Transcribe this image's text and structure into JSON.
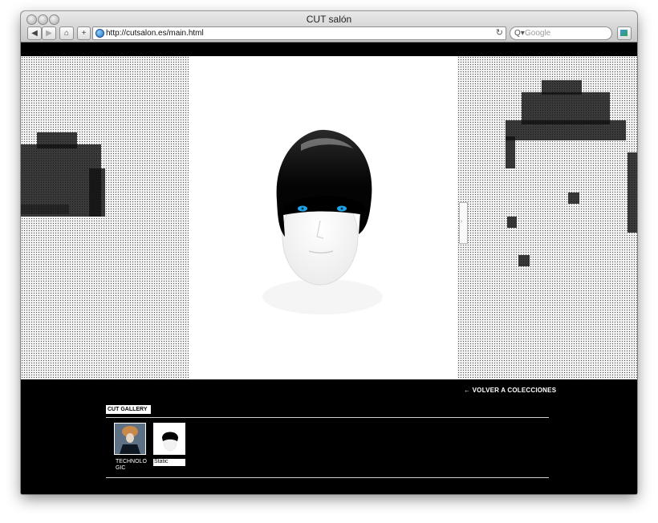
{
  "browser": {
    "window_title": "CUT salón",
    "url": "http://cutsalon.es/main.html",
    "search_placeholder": "Google",
    "back_glyph": "◀",
    "forward_glyph": "▶",
    "home_glyph": "⌂",
    "add_glyph": "+",
    "reload_glyph": "↻",
    "search_glyph": "Q▾"
  },
  "page": {
    "back_link": "← VOLVER A COLECCIONES",
    "gallery_title": "CUT GALLERY",
    "side_tab_glyph": "›",
    "thumbnails": [
      {
        "label": "TECHNOLOGIC",
        "label_lines": [
          "TECHNOLO",
          "GIC"
        ]
      },
      {
        "label": "Static"
      }
    ]
  },
  "colors": {
    "page_background": "#000000",
    "photo_background": "#ffffff",
    "eye_accent": "#1fa3e6",
    "text_primary": "#ffffff"
  },
  "icons": [
    "back-icon",
    "forward-icon",
    "home-icon",
    "add-tab-icon",
    "globe-icon",
    "reload-icon",
    "search-icon",
    "bookmarks-icon"
  ]
}
